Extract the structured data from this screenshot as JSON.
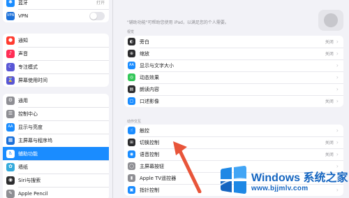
{
  "sidebar": {
    "group1": [
      {
        "label": "蓝牙",
        "icon": "bluetooth-icon",
        "color": "#1a8cff",
        "glyph": "✱",
        "value": "打开"
      },
      {
        "label": "VPN",
        "icon": "vpn-icon",
        "color": "#1a6fd9",
        "glyph": "VPN",
        "toggle": "off"
      }
    ],
    "group2": [
      {
        "label": "通知",
        "icon": "notifications-icon",
        "color": "#ff3b30",
        "glyph": "●"
      },
      {
        "label": "声音",
        "icon": "sound-icon",
        "color": "#ff2d55",
        "glyph": "♪"
      },
      {
        "label": "专注模式",
        "icon": "focus-icon",
        "color": "#5856d6",
        "glyph": "☾"
      },
      {
        "label": "屏幕使用时间",
        "icon": "screen-time-icon",
        "color": "#5856d6",
        "glyph": "⌛"
      }
    ],
    "group3": [
      {
        "label": "通用",
        "icon": "general-gear-icon",
        "color": "#8e8e93",
        "glyph": "⚙"
      },
      {
        "label": "控制中心",
        "icon": "control-center-icon",
        "color": "#8e8e93",
        "glyph": "☰"
      },
      {
        "label": "显示与亮度",
        "icon": "display-brightness-icon",
        "color": "#1a8cff",
        "glyph": "AA"
      },
      {
        "label": "主屏幕与程序坞",
        "icon": "home-screen-dock-icon",
        "color": "#1a6fd9",
        "glyph": "▦"
      },
      {
        "label": "辅助功能",
        "icon": "accessibility-icon",
        "color": "#1a8cff",
        "glyph": "♿",
        "active": true
      },
      {
        "label": "墙纸",
        "icon": "wallpaper-icon",
        "color": "#34aadc",
        "glyph": "✿"
      },
      {
        "label": "Siri与搜索",
        "icon": "siri-icon",
        "color": "#2c2c2e",
        "glyph": "◉"
      },
      {
        "label": "Apple Pencil",
        "icon": "apple-pencil-icon",
        "color": "#8e8e93",
        "glyph": "✎"
      }
    ]
  },
  "detail": {
    "intro": "\"辅助功能\"可帮助您使用 iPad，以满足您的个人需要。",
    "vision_header": "视觉",
    "vision": [
      {
        "label": "旁白",
        "icon": "voiceover-icon",
        "color": "#2c2c2e",
        "glyph": "◐",
        "value": "关闭"
      },
      {
        "label": "缩放",
        "icon": "zoom-icon",
        "color": "#2c2c2e",
        "glyph": "⊕",
        "value": "关闭"
      },
      {
        "label": "显示与文字大小",
        "icon": "display-text-size-icon",
        "color": "#1a8cff",
        "glyph": "AA",
        "value": ""
      },
      {
        "label": "动态效果",
        "icon": "motion-icon",
        "color": "#34c759",
        "glyph": "◎",
        "value": ""
      },
      {
        "label": "朗读内容",
        "icon": "spoken-content-icon",
        "color": "#2c2c2e",
        "glyph": "▤",
        "value": ""
      },
      {
        "label": "口述影像",
        "icon": "audio-descriptions-icon",
        "color": "#1a8cff",
        "glyph": "▢",
        "value": "关闭"
      }
    ],
    "interaction_header": "动作交互",
    "interaction": [
      {
        "label": "触控",
        "icon": "touch-icon",
        "color": "#1a8cff",
        "glyph": "☝",
        "value": ""
      },
      {
        "label": "切换控制",
        "icon": "switch-control-icon",
        "color": "#2c2c2e",
        "glyph": "⊞",
        "value": "关闭"
      },
      {
        "label": "语音控制",
        "icon": "voice-control-icon",
        "color": "#1a8cff",
        "glyph": "◉",
        "value": "关闭"
      },
      {
        "label": "主屏幕按钮",
        "icon": "home-button-icon",
        "color": "#8e8e93",
        "glyph": "◯",
        "value": ""
      },
      {
        "label": "Apple TV遥控器",
        "icon": "apple-tv-remote-icon",
        "color": "#8e8e93",
        "glyph": "▮",
        "value": ""
      },
      {
        "label": "指针控制",
        "icon": "pointer-control-icon",
        "color": "#1a8cff",
        "glyph": "▣",
        "value": ""
      }
    ]
  },
  "watermark": {
    "title_en": "Windows",
    "title_cn": " 系统之家",
    "url": "www.bjjmlv.com"
  },
  "colors": {
    "accent": "#1a8cff",
    "annotation_arrow": "#e8553a"
  }
}
